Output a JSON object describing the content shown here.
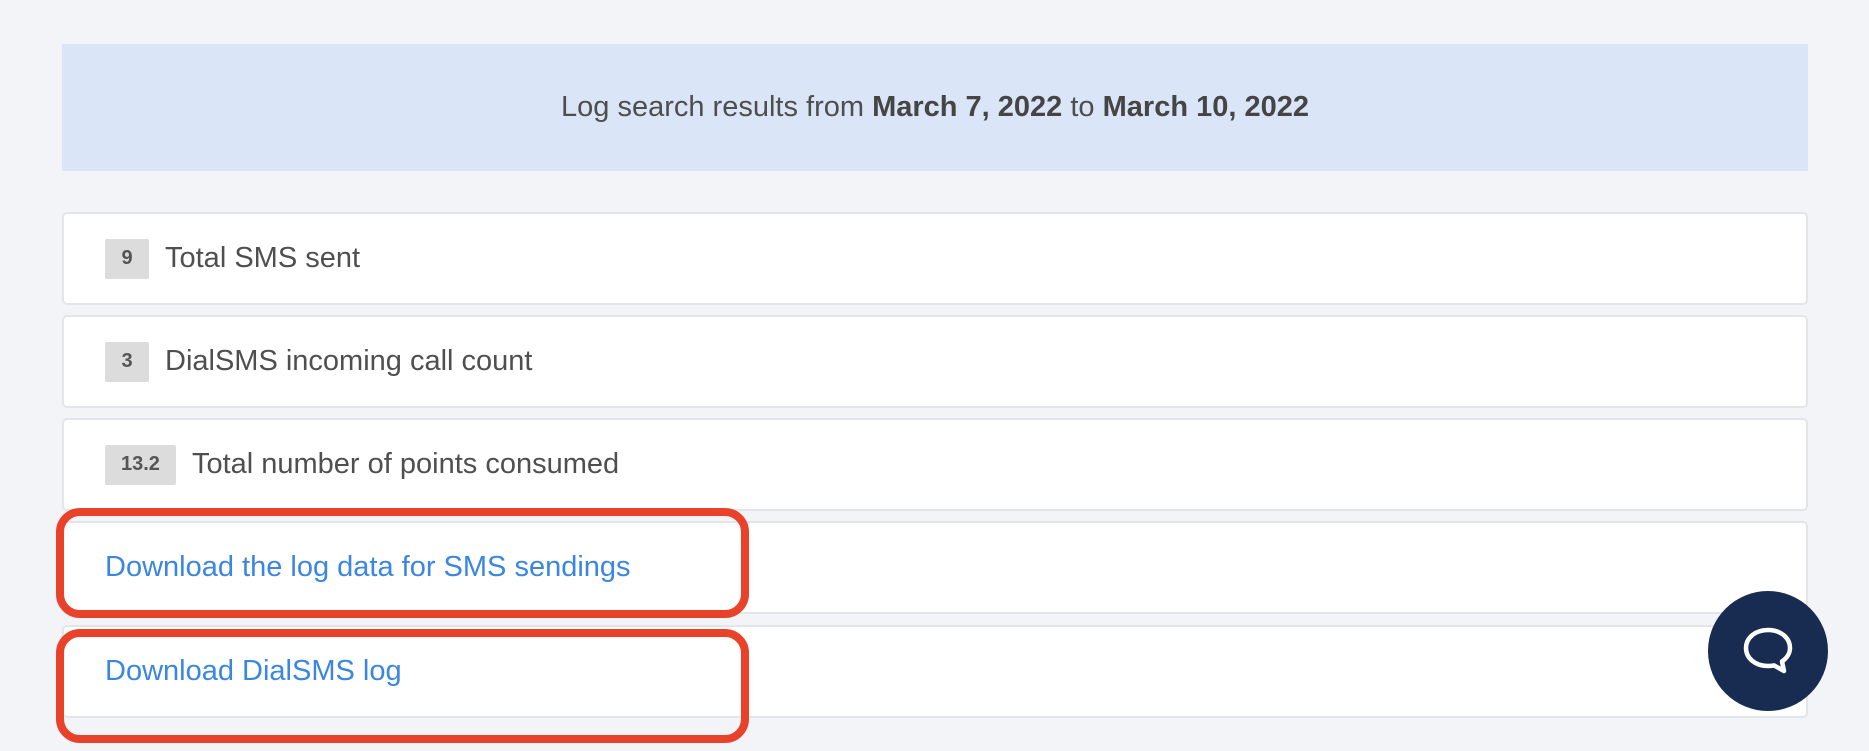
{
  "banner": {
    "prefix": "Log search results from ",
    "start_date": "March 7, 2022",
    "middle": " to ",
    "end_date": "March 10, 2022"
  },
  "stats": [
    {
      "value": "9",
      "label": "Total SMS sent"
    },
    {
      "value": "3",
      "label": "DialSMS incoming call count"
    },
    {
      "value": "13.2",
      "label": "Total number of points consumed"
    }
  ],
  "downloads": [
    {
      "label": "Download the log data for SMS sendings"
    },
    {
      "label": "Download DialSMS log"
    }
  ],
  "colors": {
    "link": "#3a86e0",
    "highlight": "#e8432a",
    "chat_button": "#182c52",
    "banner_bg": "#dae5f7"
  },
  "chat": {
    "icon": "chat-bubble-icon"
  }
}
